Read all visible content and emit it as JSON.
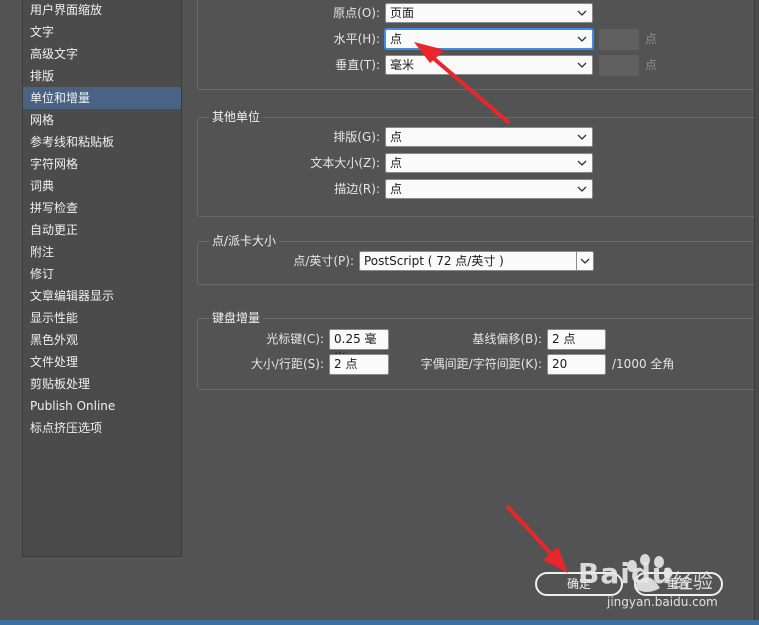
{
  "sidebar": {
    "items": [
      {
        "label": "用户界面缩放",
        "active": false
      },
      {
        "label": "文字",
        "active": false
      },
      {
        "label": "高级文字",
        "active": false
      },
      {
        "label": "排版",
        "active": false
      },
      {
        "label": "单位和增量",
        "active": true
      },
      {
        "label": "网格",
        "active": false
      },
      {
        "label": "参考线和粘贴板",
        "active": false
      },
      {
        "label": "字符网格",
        "active": false
      },
      {
        "label": "词典",
        "active": false
      },
      {
        "label": "拼写检查",
        "active": false
      },
      {
        "label": "自动更正",
        "active": false
      },
      {
        "label": "附注",
        "active": false
      },
      {
        "label": "修订",
        "active": false
      },
      {
        "label": "文章编辑器显示",
        "active": false
      },
      {
        "label": "显示性能",
        "active": false
      },
      {
        "label": "黑色外观",
        "active": false
      },
      {
        "label": "文件处理",
        "active": false
      },
      {
        "label": "剪贴板处理",
        "active": false
      },
      {
        "label": "Publish Online",
        "active": false
      },
      {
        "label": "标点挤压选项",
        "active": false
      }
    ]
  },
  "ruler_units": {
    "origin_label": "原点(O):",
    "origin_value": "页面",
    "horizontal_label": "水平(H):",
    "horizontal_value": "点",
    "horizontal_unit": "点",
    "vertical_label": "垂直(T):",
    "vertical_value": "毫米",
    "vertical_unit": "点"
  },
  "other_units": {
    "title": "其他单位",
    "composition_label": "排版(G):",
    "composition_value": "点",
    "text_size_label": "文本大小(Z):",
    "text_size_value": "点",
    "stroke_label": "描边(R):",
    "stroke_value": "点"
  },
  "point_pica": {
    "title": "点/派卡大小",
    "label": "点/英寸(P):",
    "value": "PostScript ( 72 点/英寸 )"
  },
  "keyboard": {
    "title": "键盘增量",
    "cursor_label": "光标键(C):",
    "cursor_value": "0.25 毫米",
    "baseline_label": "基线偏移(B):",
    "baseline_value": "2 点",
    "size_label": "大小/行距(S):",
    "size_value": "2 点",
    "kerning_label": "字偶间距/字符间距(K):",
    "kerning_value": "20",
    "kerning_unit": "/1000 全角"
  },
  "buttons": {
    "ok": "确定",
    "reset": "重置"
  },
  "watermark": {
    "brand": "Baidu",
    "jingyan": "经验",
    "url": "jingyan.baidu.com"
  },
  "colors": {
    "accent_arrow": "#e8262b",
    "selected": "#4a6385",
    "focus": "#3d8ee6"
  }
}
